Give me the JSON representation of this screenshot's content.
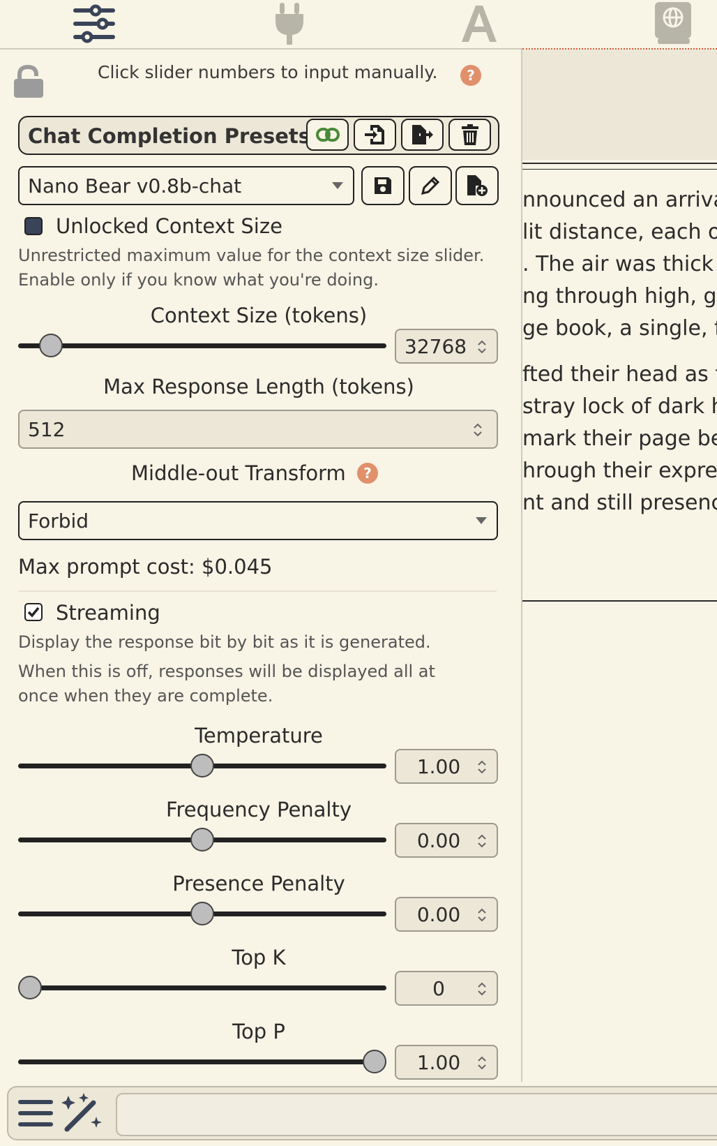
{
  "top_nav": {
    "icons": [
      "sliders-icon",
      "plug-icon",
      "font-icon",
      "book-globe-icon"
    ]
  },
  "panel": {
    "hint": "Click slider numbers to input manually.",
    "presets": {
      "title": "Chat Completion Presets",
      "selected": "Nano Bear v0.8b-chat"
    },
    "unlocked_context": {
      "label": "Unlocked Context Size",
      "checked": false,
      "desc": "Unrestricted maximum value for the context size slider. Enable only if you know what you're doing."
    },
    "context_size": {
      "label": "Context Size (tokens)",
      "value": "32768",
      "fraction": 0.06
    },
    "max_response": {
      "label": "Max Response Length (tokens)",
      "value": "512"
    },
    "middle_out": {
      "label": "Middle-out Transform",
      "selected": "Forbid"
    },
    "max_prompt_cost": "Max prompt cost: $0.045",
    "streaming": {
      "label": "Streaming",
      "checked": true,
      "desc1": "Display the response bit by bit as it is generated.",
      "desc2": "When this is off, responses will be displayed all at once when they are complete."
    },
    "sliders": [
      {
        "label": "Temperature",
        "value": "1.00",
        "fraction": 0.5
      },
      {
        "label": "Frequency Penalty",
        "value": "0.00",
        "fraction": 0.5
      },
      {
        "label": "Presence Penalty",
        "value": "0.00",
        "fraction": 0.5
      },
      {
        "label": "Top K",
        "value": "0",
        "fraction": 0.0
      },
      {
        "label": "Top P",
        "value": "1.00",
        "fraction": 1.0
      }
    ]
  },
  "chat": {
    "lines": [
      "nnounced an arrival",
      "lit distance, each or",
      ". The air was thick w",
      "ng through high, gr",
      "ge book, a single, fo",
      "fted their head as th",
      "stray lock of dark ha",
      "mark their page be",
      "hrough their expres",
      "nt and still presence"
    ]
  },
  "colors": {
    "background": "#f8f4e6",
    "accent_help": "#e0906a",
    "link_green": "#4a8a3a"
  }
}
